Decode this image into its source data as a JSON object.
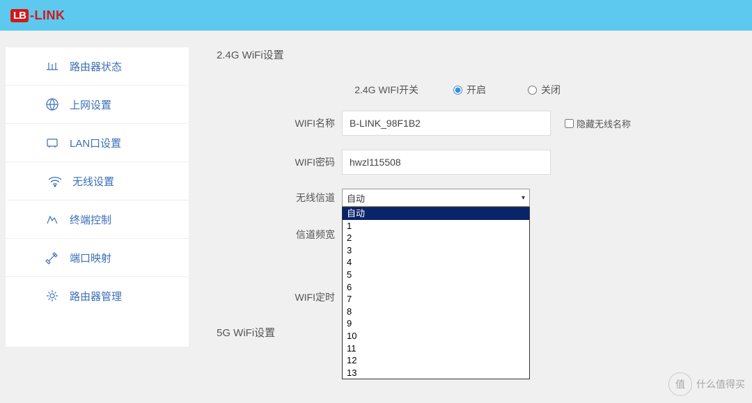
{
  "header": {
    "logo_badge": "LB",
    "logo_text": "-LINK"
  },
  "sidebar": {
    "items": [
      {
        "label": "路由器状态"
      },
      {
        "label": "上网设置"
      },
      {
        "label": "LAN口设置"
      },
      {
        "label": "无线设置"
      },
      {
        "label": "终端控制"
      },
      {
        "label": "端口映射"
      },
      {
        "label": "路由器管理"
      }
    ]
  },
  "main": {
    "section_24g_title": "2.4G WiFi设置",
    "section_5g_title": "5G WiFi设置",
    "labels": {
      "wifi_switch": "2.4G WIFI开关",
      "wifi_name": "WIFI名称",
      "wifi_password": "WIFI密码",
      "channel": "无线信道",
      "bandwidth": "信道频宽",
      "timer": "WIFI定时"
    },
    "radio": {
      "on": "开启",
      "off": "关闭"
    },
    "wifi_name_value": "B-LINK_98F1B2",
    "wifi_password_value": "hwzl115508",
    "hide_ssid_label": "隐藏无线名称",
    "channel_selected": "自动",
    "channel_options": [
      "自动",
      "1",
      "2",
      "3",
      "4",
      "5",
      "6",
      "7",
      "8",
      "9",
      "10",
      "11",
      "12",
      "13"
    ]
  },
  "watermark": {
    "char": "值",
    "text": "什么值得买"
  }
}
